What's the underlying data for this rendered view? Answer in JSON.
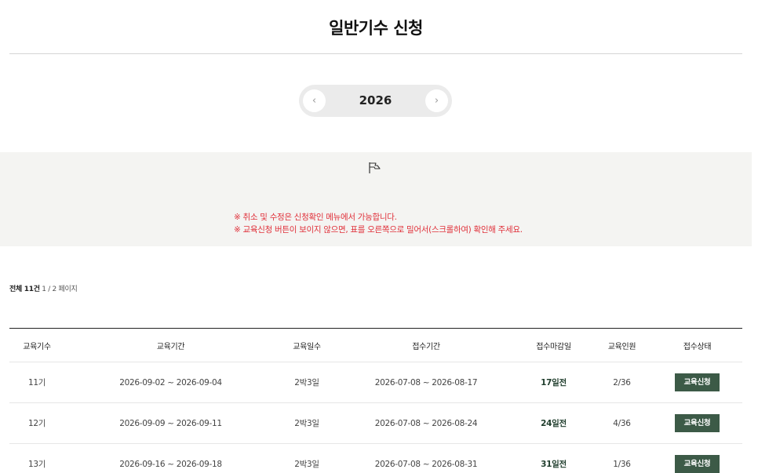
{
  "page": {
    "title": "일반기수 신청"
  },
  "year_selector": {
    "prev_icon": "‹",
    "next_icon": "›",
    "year": "2026"
  },
  "notice": {
    "icon": "flag-icon",
    "items": [
      "※ 취소 및 수정은 신청확인 메뉴에서 가능합니다.",
      "※ 교육신청 버튼이 보이지 않으면, 표를 오른쪽으로 밀어서(스크롤하여) 확인해 주세요."
    ]
  },
  "summary": {
    "total_label": "전체 11건",
    "page_info": "1 / 2 페이지"
  },
  "table": {
    "headers": [
      "교육기수",
      "교육기간",
      "교육일수",
      "접수기간",
      "접수마감일",
      "교육인원",
      "접수상태"
    ],
    "rows": [
      {
        "cohort": "11기",
        "period": "2026-09-02 ~ 2026-09-04",
        "days": "2박3일",
        "reception": "2026-07-08 ~ 2026-08-17",
        "deadline": "17일전",
        "capacity": "2/36",
        "status": "교육신청"
      },
      {
        "cohort": "12기",
        "period": "2026-09-09 ~ 2026-09-11",
        "days": "2박3일",
        "reception": "2026-07-08 ~ 2026-08-24",
        "deadline": "24일전",
        "capacity": "4/36",
        "status": "교육신청"
      },
      {
        "cohort": "13기",
        "period": "2026-09-16 ~ 2026-09-18",
        "days": "2박3일",
        "reception": "2026-07-08 ~ 2026-08-31",
        "deadline": "31일전",
        "capacity": "1/36",
        "status": "교육신청"
      }
    ]
  },
  "colors": {
    "accent_green": "#3c5a47",
    "notice_red": "#e0303a"
  }
}
